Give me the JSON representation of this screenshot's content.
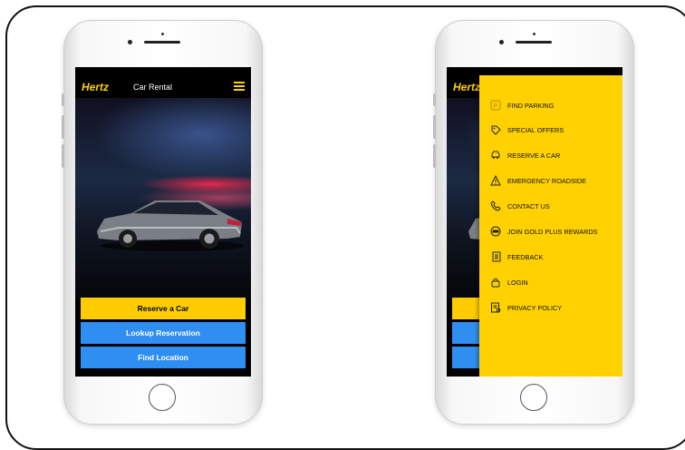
{
  "left_screen": {
    "logo": "Hertz",
    "title": "Car Rental",
    "buttons": [
      {
        "label": "Reserve a Car",
        "color": "#ffcc00"
      },
      {
        "label": "Lookup Reservation",
        "color": "#2f8ef2"
      },
      {
        "label": "Find Location",
        "color": "#2f8ef2"
      }
    ]
  },
  "right_screen": {
    "logo_partial": "Hertz",
    "menu_items": [
      {
        "label": "FIND PARKING",
        "icon": "parking-icon"
      },
      {
        "label": "SPECIAL OFFERS",
        "icon": "tag-icon"
      },
      {
        "label": "RESERVE A CAR",
        "icon": "car-icon"
      },
      {
        "label": "EMERGENCY ROADSIDE",
        "icon": "warning-icon"
      },
      {
        "label": "CONTACT US",
        "icon": "phone-icon"
      },
      {
        "label": "JOIN GOLD PLUS REWARDS",
        "icon": "gold-badge-icon"
      },
      {
        "label": "FEEDBACK",
        "icon": "feedback-icon"
      },
      {
        "label": "LOGIN",
        "icon": "lock-icon"
      },
      {
        "label": "PRIVACY POLICY",
        "icon": "document-icon"
      }
    ]
  },
  "colors": {
    "brand_yellow": "#ffd100",
    "button_blue": "#2f8ef2",
    "app_bar": "#000000"
  }
}
